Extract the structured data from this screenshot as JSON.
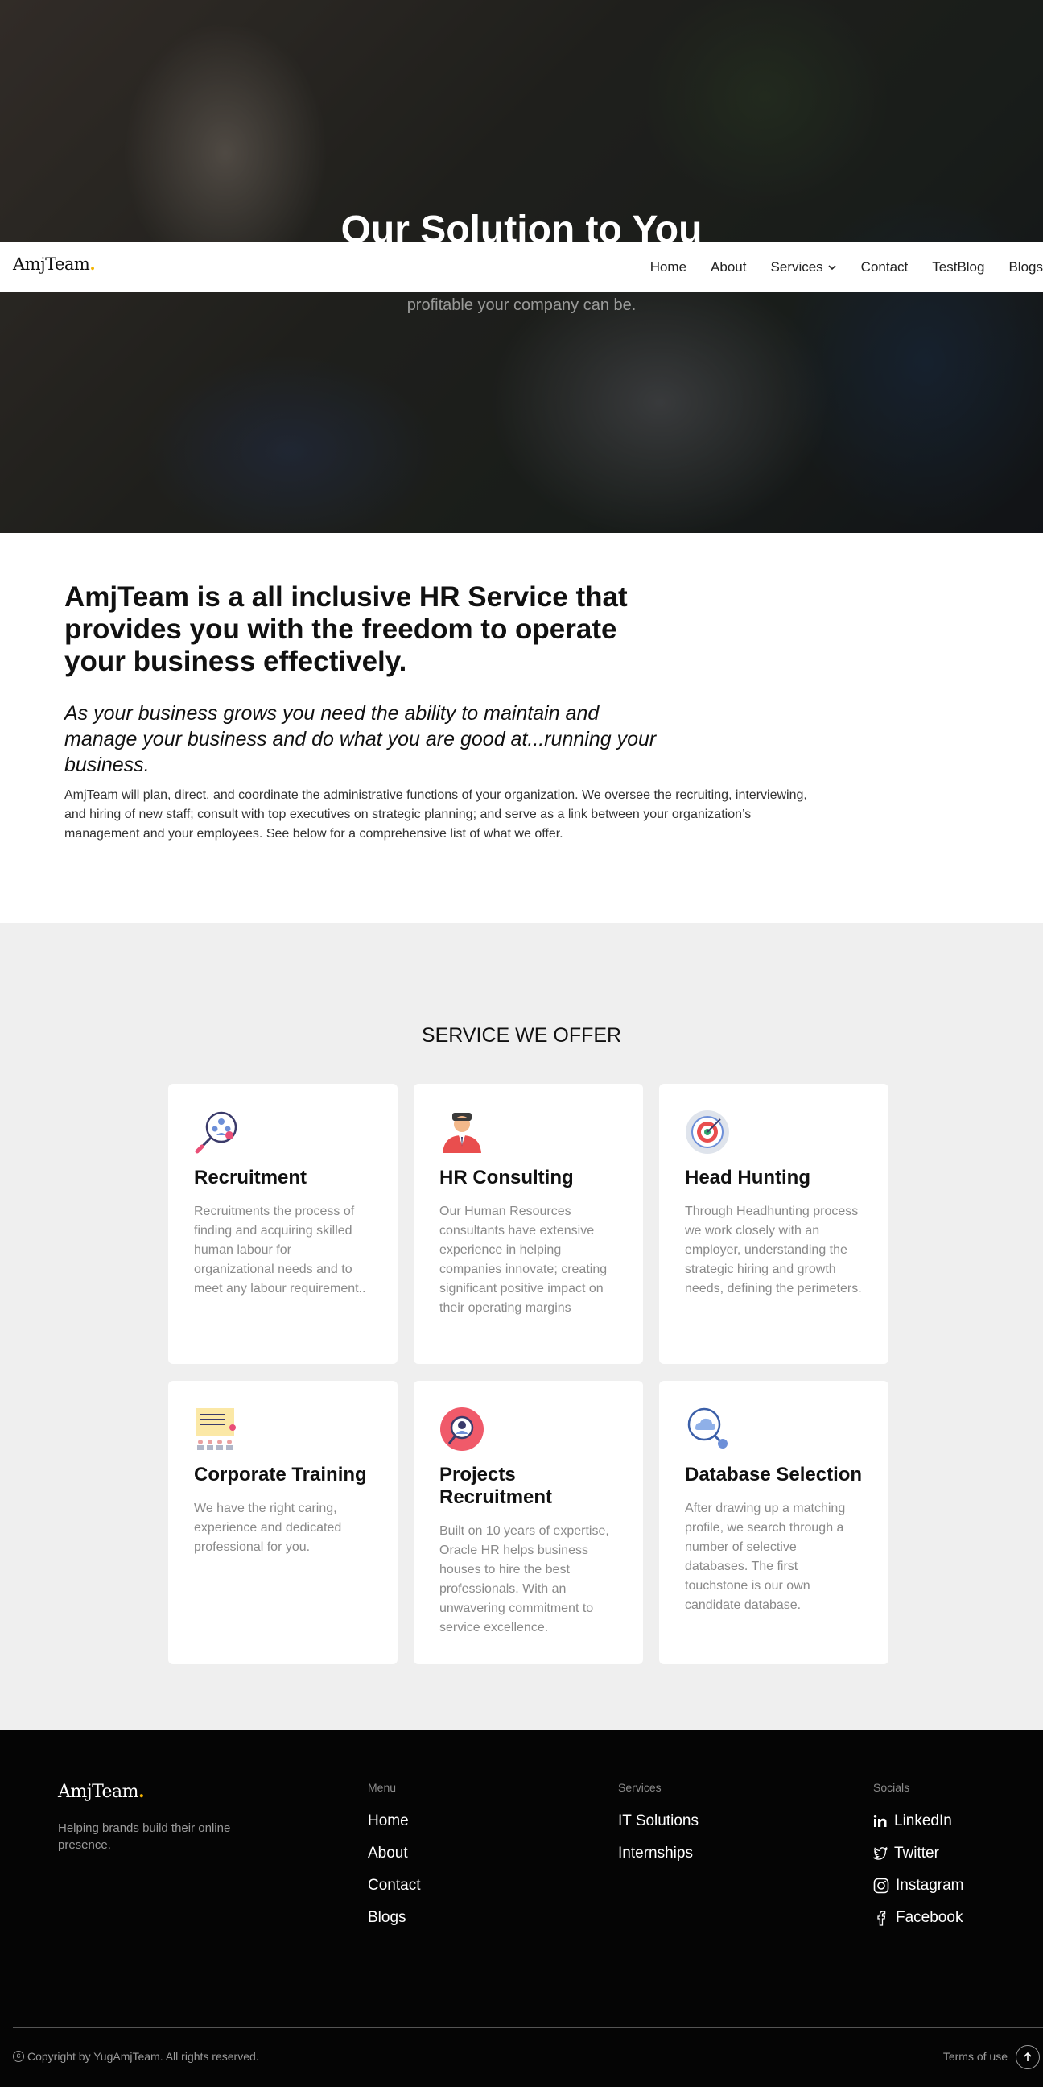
{
  "hero": {
    "title": "Our Solution to You",
    "subtitle": "profitable your company can be."
  },
  "nav": {
    "logo": "AmjTeam",
    "logo_dot": ".",
    "items": [
      "Home",
      "About",
      "Services",
      "Contact",
      "TestBlog",
      "Blogs"
    ]
  },
  "about": {
    "heading": "AmjTeam is a all inclusive HR Service that provides you with the freedom to operate your business effectively.",
    "subheading": "As your business grows you need the ability to maintain and manage your business and do what you are good at...running your business.",
    "body": "AmjTeam will plan, direct, and coordinate the administrative functions of your organization. We oversee the recruiting, interviewing, and hiring of new staff; consult with top executives on strategic planning; and serve as a link between your organization’s management and your employees. See below for a comprehensive list of what we offer."
  },
  "services": {
    "title": "SERVICE WE OFFER",
    "cards": [
      {
        "icon": "recruitment-magnifier-icon",
        "title": "Recruitment",
        "text": "Recruitments the process of finding and acquiring skilled human labour for organizational needs and to meet any labour requirement.."
      },
      {
        "icon": "hr-consultant-icon",
        "title": "HR Consulting",
        "text": "Our Human Resources consultants have extensive experience in helping companies innovate; creating significant positive impact on their operating margins"
      },
      {
        "icon": "target-icon",
        "title": "Head Hunting",
        "text": "Through Headhunting process we work closely with an employer, understanding the strategic hiring and growth needs, defining the perimeters."
      },
      {
        "icon": "training-board-icon",
        "title": "Corporate Training",
        "text": "We have the right caring, experience and dedicated professional for you."
      },
      {
        "icon": "candidate-search-icon",
        "title": "Projects Recruitment",
        "text": "Built on 10 years of expertise, Oracle HR helps business houses to hire the best professionals. With an unwavering commitment to service excellence."
      },
      {
        "icon": "cloud-database-icon",
        "title": "Database Selection",
        "text": "After drawing up a matching profile, we search through a number of selective databases. The first touchstone is our own candidate database."
      }
    ]
  },
  "footer": {
    "logo": "AmjTeam",
    "logo_dot": ".",
    "tagline": "Helping brands build their online presence.",
    "menu": {
      "heading": "Menu",
      "links": [
        "Home",
        "About",
        "Contact",
        "Blogs"
      ]
    },
    "services": {
      "heading": "Services",
      "links": [
        "IT Solutions",
        "Internships"
      ]
    },
    "socials": {
      "heading": "Socials",
      "links": [
        "LinkedIn",
        "Twitter",
        "Instagram",
        "Facebook"
      ]
    },
    "copyright": "Copyright by YugAmjTeam. All rights reserved.",
    "terms": "Terms of use"
  },
  "colors": {
    "accent_dot": "#f4b400",
    "footer_bg": "#050505",
    "services_bg": "#efefef"
  }
}
